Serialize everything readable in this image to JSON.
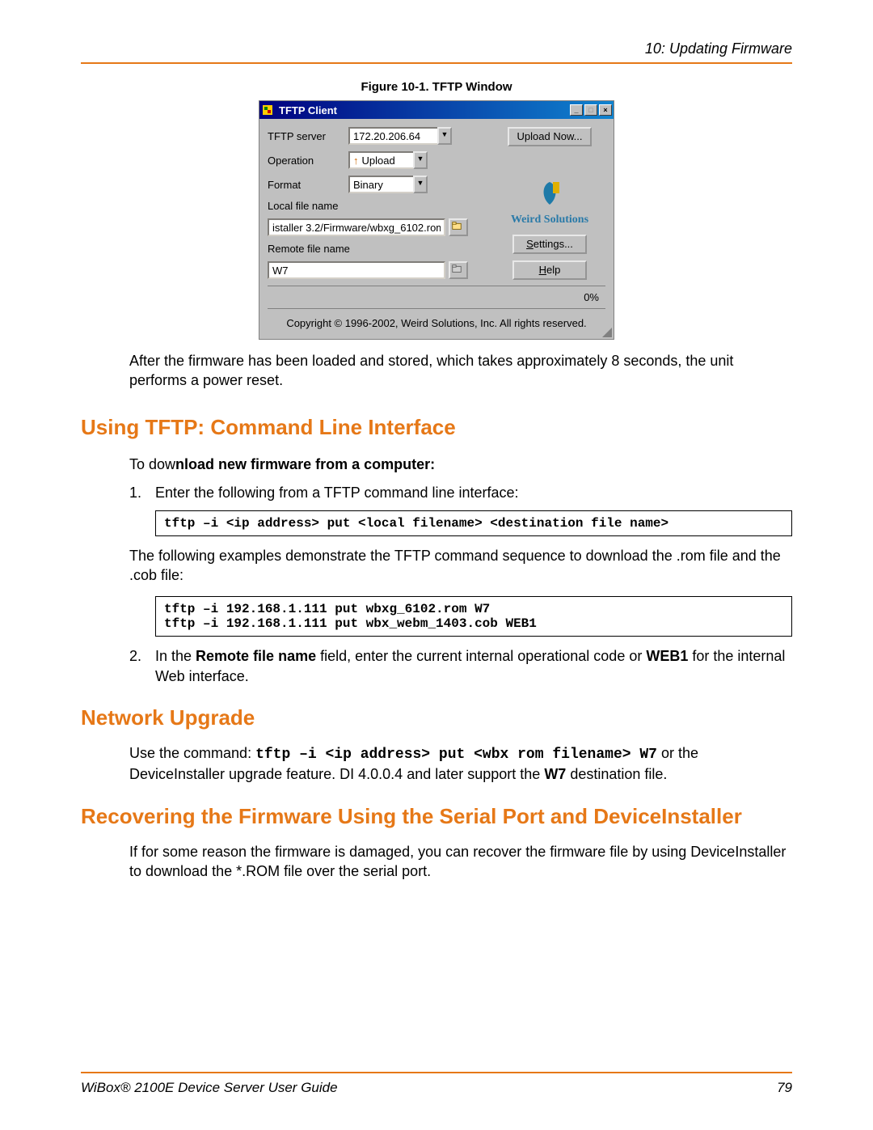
{
  "header": {
    "text": "10: Updating Firmware"
  },
  "figure_caption": "Figure 10-1. TFTP Window",
  "tftp": {
    "title": "TFTP Client",
    "labels": {
      "server": "TFTP server",
      "operation": "Operation",
      "format": "Format",
      "localfile": "Local file name",
      "remotefile": "Remote file name"
    },
    "values": {
      "server": "172.20.206.64",
      "operation": "Upload",
      "format": "Binary",
      "localfile": "istaller 3.2/Firmware/wbxg_6102.rom",
      "remotefile": "W7"
    },
    "buttons": {
      "upload": "Upload Now...",
      "settings": "Settings...",
      "help": "Help"
    },
    "brand": "Weird Solutions",
    "progress": "0%",
    "copyright": "Copyright © 1996-2002, Weird Solutions, Inc. All rights reserved."
  },
  "after_figure": "After the firmware has been loaded and stored, which takes approximately 8 seconds, the unit performs a power reset.",
  "sec1": {
    "heading": "Using TFTP: Command Line Interface",
    "intro_lead": "To dow",
    "intro_bold": "nload new firmware from a computer:",
    "step1": "Enter the following from a TFTP command line interface:",
    "code1": "tftp –i <ip address> put <local filename> <destination file name>",
    "para1": "The following examples demonstrate the TFTP command sequence to download the .rom file and the .cob file:",
    "code2a": "tftp –i 192.168.1.111 put wbxg_6102.rom W7",
    "code2b": "tftp –i 192.168.1.111 put  wbx_webm_1403.cob  WEB1",
    "step2_a": "In the ",
    "step2_b": "Remote file name",
    "step2_c": " field, enter the current internal operational code or ",
    "step2_d": "WEB1",
    "step2_e": " for the internal Web interface."
  },
  "sec2": {
    "heading": "Network Upgrade",
    "p1a": "Use the command: ",
    "p1b": "tftp –i <ip address> put <wbx rom filename> W7",
    "p1c": " or the DeviceInstaller upgrade feature. DI 4.0.0.4 and later support the ",
    "p1d": "W7",
    "p1e": " destination file."
  },
  "sec3": {
    "heading": "Recovering the Firmware Using the Serial Port and DeviceInstaller",
    "p1": "If for some reason the firmware is damaged, you can recover the firmware file by using DeviceInstaller to download the *.ROM file over the serial port."
  },
  "footer": {
    "left": "WiBox® 2100E Device Server User Guide",
    "right": "79"
  }
}
